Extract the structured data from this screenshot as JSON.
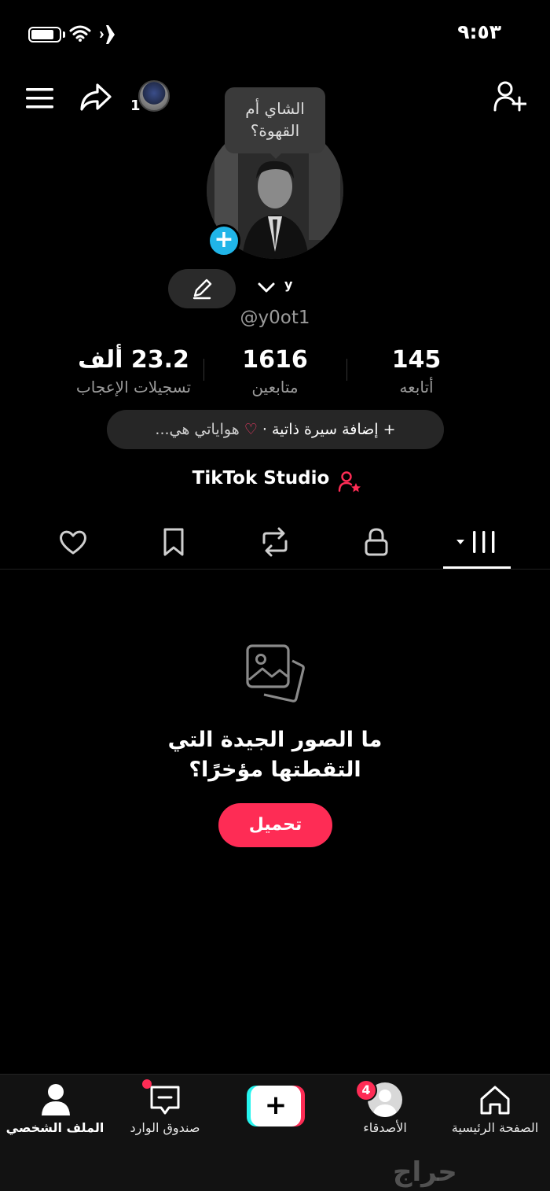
{
  "status_bar": {
    "time": "٩:٥٣"
  },
  "header": {
    "story_count": "1"
  },
  "profile": {
    "note_line1": "الشاي أم",
    "note_line2": "القهوة؟",
    "avatar_plus": "+",
    "account_letter": "y",
    "username": "@y0ot1",
    "stats": {
      "following_count": "145",
      "following_label": "أتابعه",
      "followers_count": "1616",
      "followers_label": "متابعين",
      "likes_count": "23.2 ألف",
      "likes_label": "تسجيلات الإعجاب"
    },
    "bio": {
      "add_bio": "+ إضافة سيرة ذاتية",
      "separator": "·",
      "heart": "♡",
      "hobbies": "هواياتي هي..."
    },
    "studio_label": "TikTok Studio"
  },
  "tabs": [
    {
      "name": "videos",
      "active": true
    },
    {
      "name": "private"
    },
    {
      "name": "reposts"
    },
    {
      "name": "saved"
    },
    {
      "name": "liked"
    }
  ],
  "empty_state": {
    "title_line1": "ما الصور الجيدة التي",
    "title_line2": "التقطتها مؤخرًا؟",
    "upload_label": "تحميل"
  },
  "bottom_nav": {
    "home": "الصفحة الرئيسية",
    "friends": "الأصدقاء",
    "friends_badge": "4",
    "create": "+",
    "inbox": "صندوق الوارد",
    "profile": "الملف الشخصي"
  },
  "watermark": "حراج",
  "colors": {
    "accent": "#fe2c55",
    "cyan": "#25f4ee",
    "plus_blue": "#20b5e8",
    "background": "#000000"
  }
}
